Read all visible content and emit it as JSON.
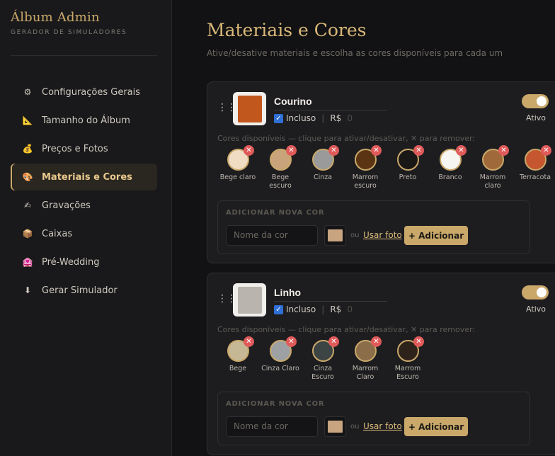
{
  "brand": {
    "title": "Álbum Admin",
    "subtitle": "GERADOR DE SIMULADORES"
  },
  "sidebar": {
    "items": [
      {
        "label": "Configurações Gerais",
        "icon": "⚙"
      },
      {
        "label": "Tamanho do Álbum",
        "icon": "📐"
      },
      {
        "label": "Preços e Fotos",
        "icon": "💰"
      },
      {
        "label": "Materiais e Cores",
        "icon": "🎨",
        "active": true
      },
      {
        "label": "Gravações",
        "icon": "✍"
      },
      {
        "label": "Caixas",
        "icon": "📦"
      },
      {
        "label": "Pré-Wedding",
        "icon": "🏩"
      },
      {
        "label": "Gerar Simulador",
        "icon": "⬇"
      }
    ]
  },
  "main": {
    "title": "Materiais e Cores",
    "subtitle": "Ative/desative materiais e escolha as cores disponíveis para cada um"
  },
  "materials": [
    {
      "name": "Courino",
      "included_label": "Incluso",
      "currency": "R$",
      "price": "0",
      "toggle_label": "Ativo",
      "colors_hint": "Cores disponíveis — clique para ativar/desativar, ✕ para remover:",
      "thumb_color": "#c2571d",
      "colors": [
        {
          "name": "Bege claro",
          "hex": "#efdcc2"
        },
        {
          "name": "Bege escuro",
          "hex": "#c9a47a"
        },
        {
          "name": "Cinza",
          "hex": "#9a9a9a"
        },
        {
          "name": "Marrom escuro",
          "hex": "#5a3413"
        },
        {
          "name": "Preto",
          "hex": "#1a1816"
        },
        {
          "name": "Branco",
          "hex": "#f7f5f2"
        },
        {
          "name": "Marrom claro",
          "hex": "#a0693a"
        },
        {
          "name": "Terracota",
          "hex": "#c5562f"
        }
      ],
      "add": {
        "title": "ADICIONAR NOVA COR",
        "placeholder": "Nome da cor",
        "ou": "ou",
        "link": "Usar foto",
        "button": "+ Adicionar"
      }
    },
    {
      "name": "Linho",
      "included_label": "Incluso",
      "currency": "R$",
      "price": "0",
      "toggle_label": "Ativo",
      "colors_hint": "Cores disponíveis — clique para ativar/desativar, ✕ para remover:",
      "thumb_color": "#b9b4ad",
      "colors": [
        {
          "name": "Bege",
          "hex": "#c7b895"
        },
        {
          "name": "Cinza Claro",
          "hex": "#9ea1a3"
        },
        {
          "name": "Cinza Escuro",
          "hex": "#3c4444"
        },
        {
          "name": "Marrom Claro",
          "hex": "#8b6d4a"
        },
        {
          "name": "Marrom Escuro",
          "hex": "#2e231a"
        }
      ],
      "add": {
        "title": "ADICIONAR NOVA COR",
        "placeholder": "Nome da cor",
        "ou": "ou",
        "link": "Usar foto",
        "button": "+ Adicionar"
      }
    }
  ]
}
